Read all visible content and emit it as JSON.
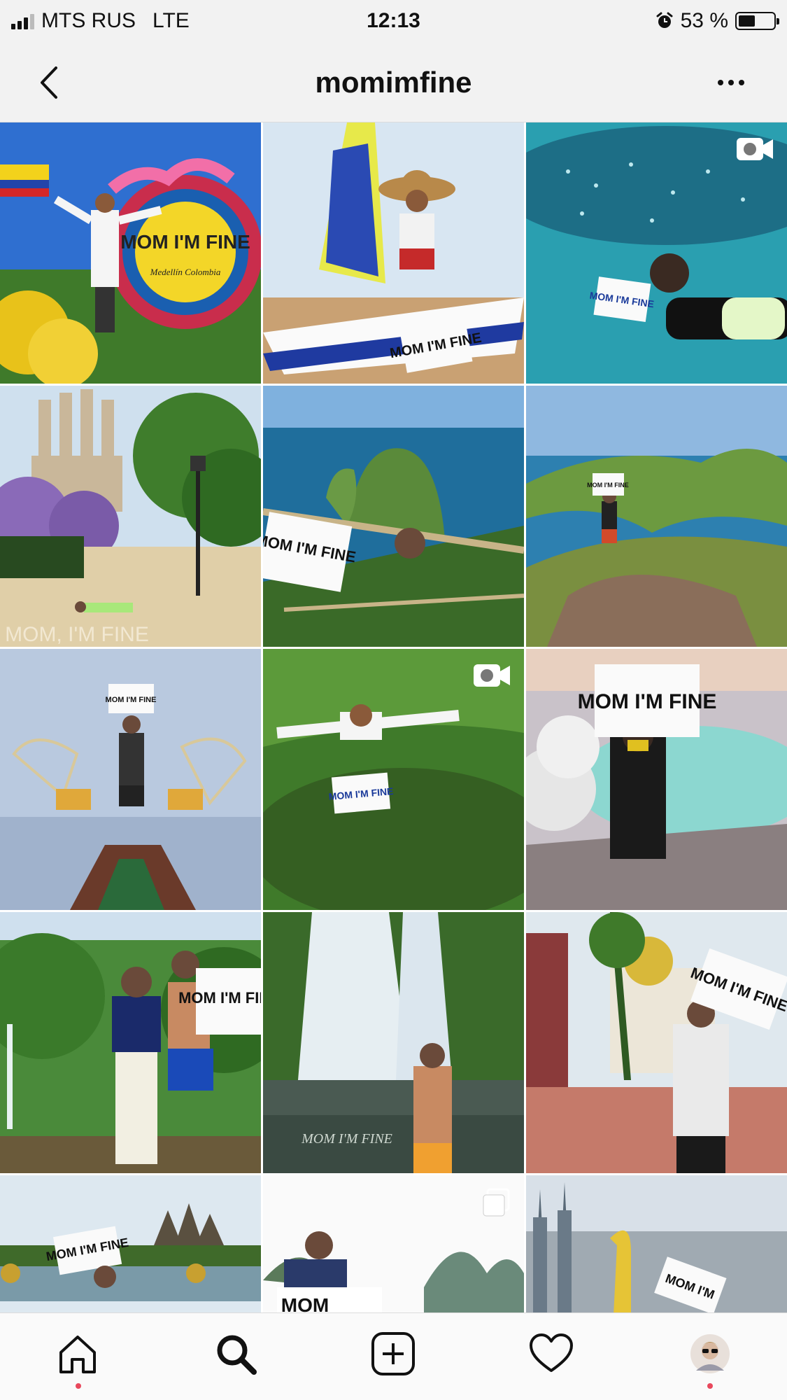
{
  "status_bar": {
    "carrier": "MTS RUS",
    "network": "LTE",
    "time": "12:13",
    "battery_percent": "53 %",
    "battery_level": 0.53
  },
  "header": {
    "title": "momimfine"
  },
  "grid": {
    "posts": [
      {
        "sign": "MOM I'M FINE",
        "sub": "Medellín Colombia",
        "type": "photo"
      },
      {
        "sign": "MOM I'M FINE",
        "type": "photo"
      },
      {
        "sign": "MOM I'M FINE",
        "type": "video"
      },
      {
        "sign": "MOM, I'M FINE",
        "type": "photo"
      },
      {
        "sign": "MOM I'M FINE",
        "type": "photo"
      },
      {
        "sign": "MOM I'M FINE",
        "type": "photo"
      },
      {
        "sign": "MOM I'M FINE",
        "type": "photo"
      },
      {
        "sign": "MOM I'M FINE",
        "type": "video"
      },
      {
        "sign": "MOM I'M FINE",
        "type": "photo"
      },
      {
        "sign": "MOM I'M FINE",
        "type": "photo"
      },
      {
        "sign": "MOM I'M FINE",
        "type": "photo"
      },
      {
        "sign": "MOM I'M FINE",
        "type": "photo"
      },
      {
        "sign": "MOM I'M FINE",
        "type": "photo"
      },
      {
        "sign": "MOM",
        "type": "carousel"
      },
      {
        "sign": "MOM I'M",
        "type": "photo"
      }
    ]
  },
  "tab_bar": {
    "items": [
      "home-icon",
      "search-icon",
      "new-post-icon",
      "activity-icon",
      "profile-avatar"
    ],
    "active": "home",
    "accent": "#e8485c"
  }
}
